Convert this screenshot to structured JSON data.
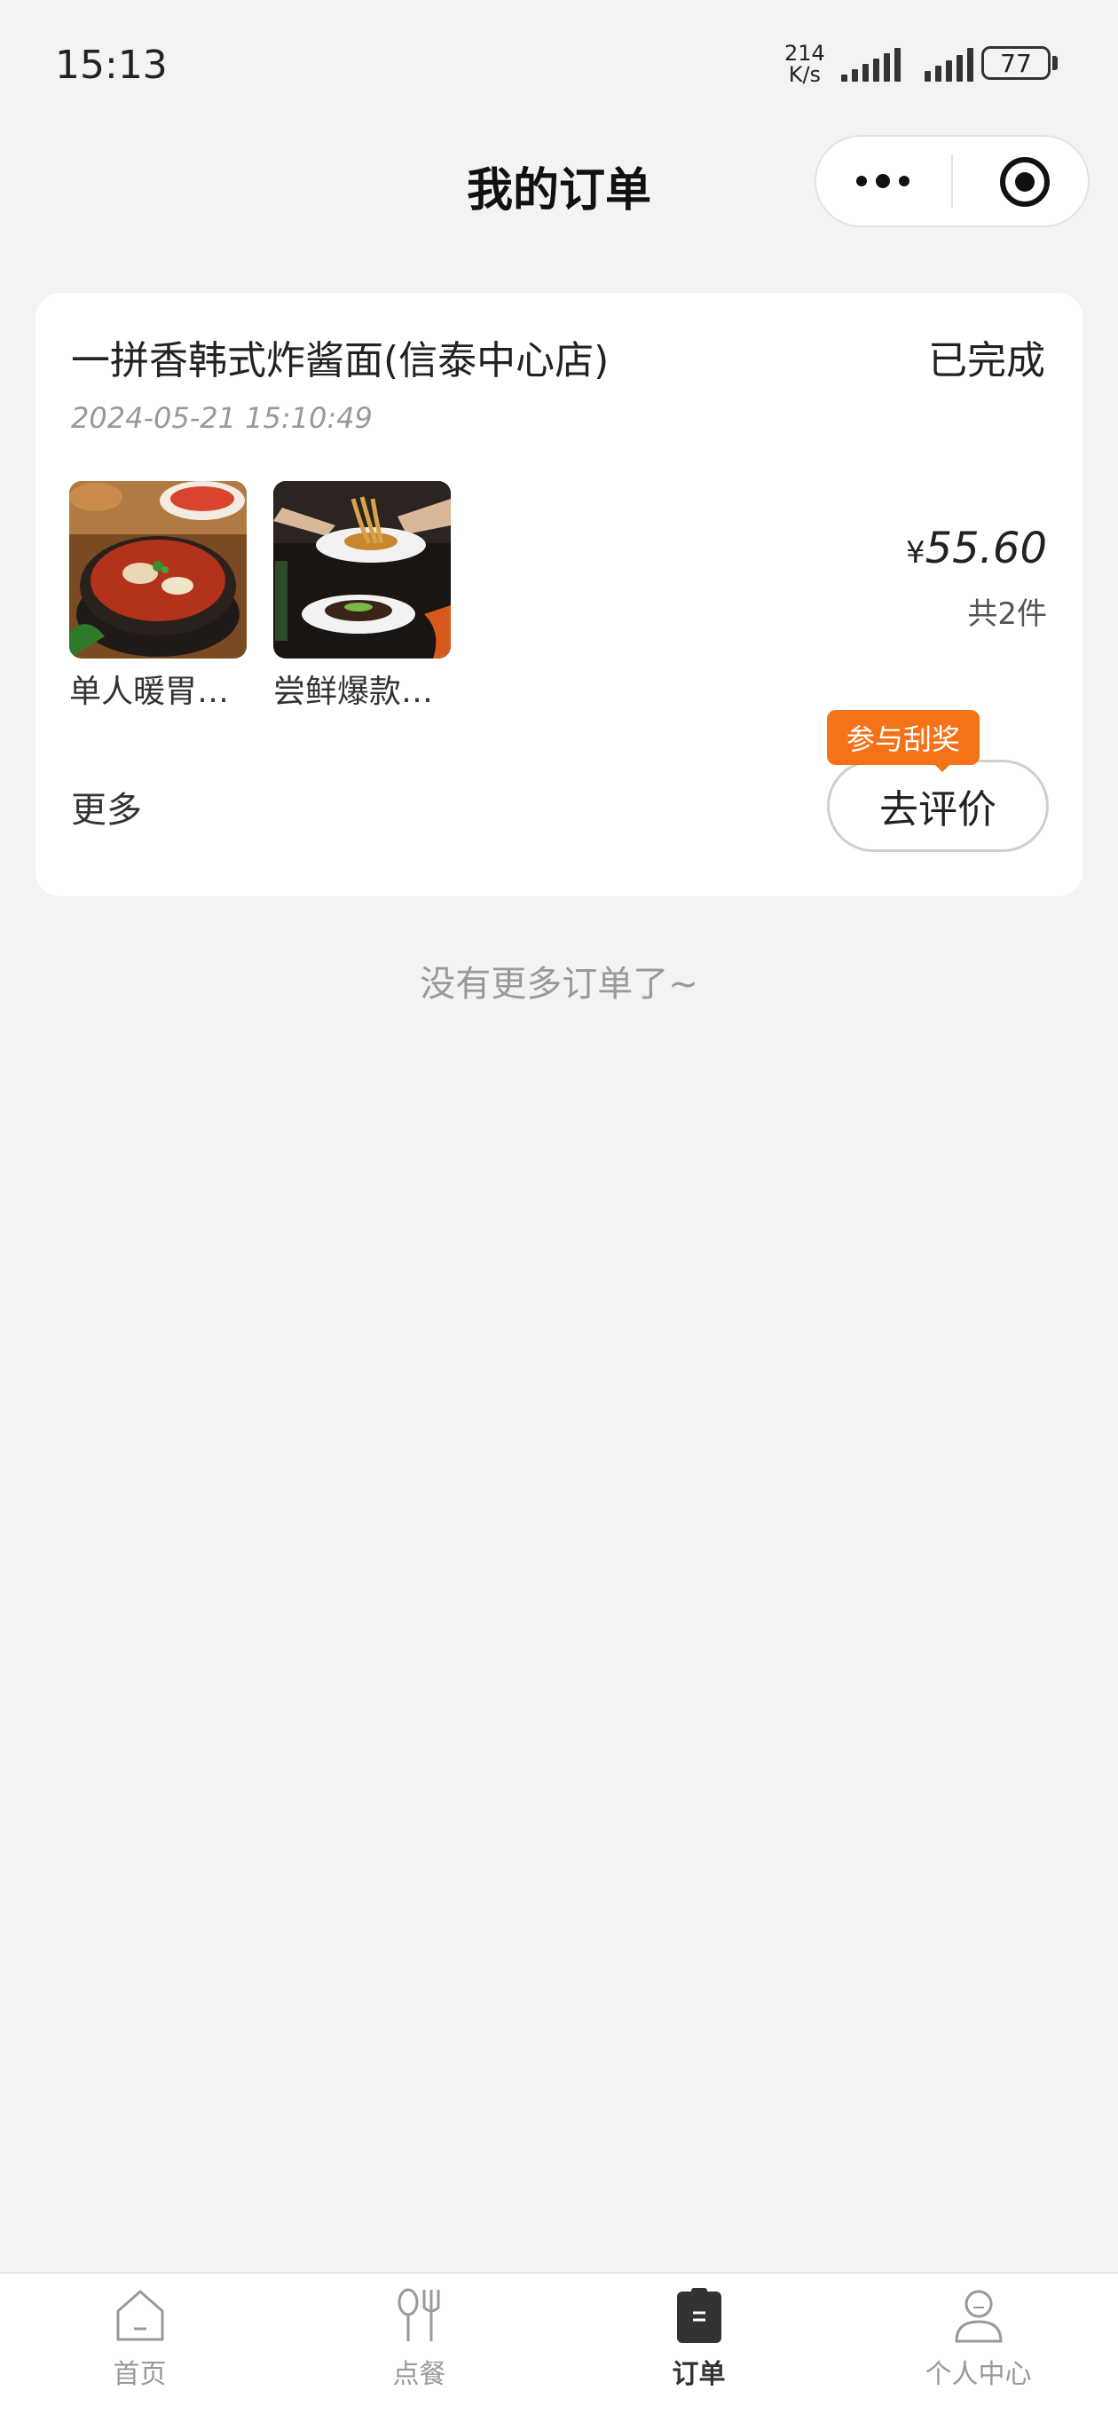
{
  "status_bar": {
    "time": "15:13",
    "net_speed_value": "214",
    "net_speed_unit": "K/s",
    "battery": "77"
  },
  "nav": {
    "title": "我的订单",
    "more_icon": "more-dots-icon",
    "close_icon": "target-icon"
  },
  "order": {
    "store_name": "一拼香韩式炸酱面(信泰中心店)",
    "status": "已完成",
    "time": "2024-05-21 15:10:49",
    "items": [
      {
        "name": "单人暖胃…"
      },
      {
        "name": "尝鲜爆款…"
      }
    ],
    "currency": "¥",
    "price": "55.60",
    "count": "共2件",
    "more_label": "更多",
    "lottery_badge": "参与刮奖",
    "review_label": "去评价"
  },
  "footer_text": "没有更多订单了~",
  "tabbar": {
    "tabs": [
      {
        "label": "首页",
        "icon": "home-icon"
      },
      {
        "label": "点餐",
        "icon": "fork-knife-icon"
      },
      {
        "label": "订单",
        "icon": "order-clipboard-icon"
      },
      {
        "label": "个人中心",
        "icon": "user-icon"
      }
    ],
    "active_index": 2
  },
  "colors": {
    "accent": "#f47218",
    "background": "#f3f3f3"
  }
}
